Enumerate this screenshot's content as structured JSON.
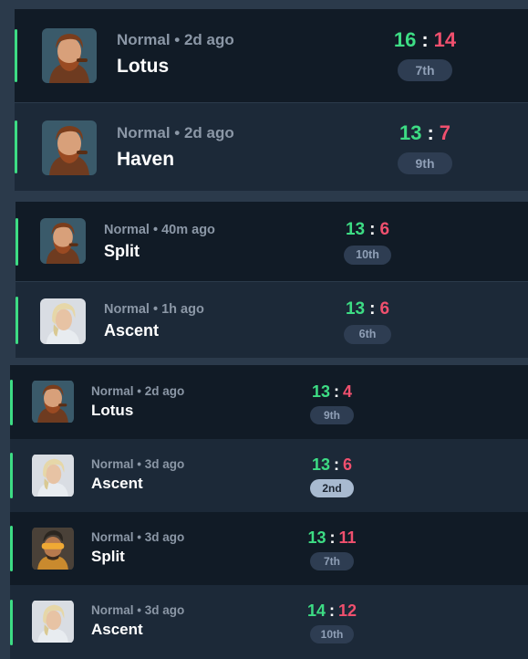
{
  "colors": {
    "win": "#3ddc84",
    "loss": "#f0506e",
    "win_indicator": "#3ddc84",
    "row_dark": "#111b26",
    "row_light": "#1c2938",
    "badge": "#2e3d52",
    "badge_highlight": "#a8bad0"
  },
  "matches": [
    {
      "mode": "Normal • 2d ago",
      "map": "Lotus",
      "score_team": "16",
      "score_sep": ":",
      "score_enemy": "14",
      "placement": "7th",
      "agent_icon": "bearded-agent-icon"
    },
    {
      "mode": "Normal • 2d ago",
      "map": "Haven",
      "score_team": "13",
      "score_sep": ":",
      "score_enemy": "7",
      "placement": "9th",
      "agent_icon": "bearded-agent-icon"
    },
    {
      "mode": "Normal • 40m ago",
      "map": "Split",
      "score_team": "13",
      "score_sep": ":",
      "score_enemy": "6",
      "placement": "10th",
      "agent_icon": "bearded-agent-icon"
    },
    {
      "mode": "Normal • 1h ago",
      "map": "Ascent",
      "score_team": "13",
      "score_sep": ":",
      "score_enemy": "6",
      "placement": "6th",
      "agent_icon": "blond-agent-icon"
    },
    {
      "mode": "Normal • 2d ago",
      "map": "Lotus",
      "score_team": "13",
      "score_sep": ":",
      "score_enemy": "4",
      "placement": "9th",
      "agent_icon": "bearded-agent-icon"
    },
    {
      "mode": "Normal • 3d ago",
      "map": "Ascent",
      "score_team": "13",
      "score_sep": ":",
      "score_enemy": "6",
      "placement": "2nd",
      "agent_icon": "blond-agent-icon"
    },
    {
      "mode": "Normal • 3d ago",
      "map": "Split",
      "score_team": "13",
      "score_sep": ":",
      "score_enemy": "11",
      "placement": "7th",
      "agent_icon": "visor-agent-icon"
    },
    {
      "mode": "Normal • 3d ago",
      "map": "Ascent",
      "score_team": "14",
      "score_sep": ":",
      "score_enemy": "12",
      "placement": "10th",
      "agent_icon": "blond-agent-icon"
    }
  ]
}
